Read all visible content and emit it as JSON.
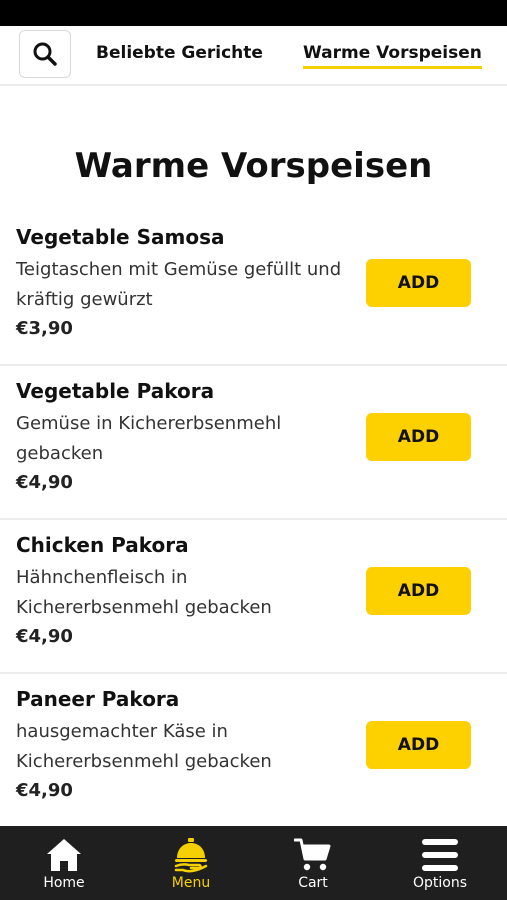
{
  "top_nav": {
    "tabs": [
      {
        "label": "Beliebte Gerichte"
      },
      {
        "label": "Warme Vorspeisen"
      }
    ]
  },
  "section": {
    "title": "Warme Vorspeisen"
  },
  "items": [
    {
      "name": "Vegetable Samosa",
      "description": "Teigtaschen mit Gemüse gefüllt und kräftig gewürzt",
      "price": "€3,90",
      "add_label": "ADD"
    },
    {
      "name": "Vegetable Pakora",
      "description": "Gemüse in Kichererbsenmehl gebacken",
      "price": "€4,90",
      "add_label": "ADD"
    },
    {
      "name": "Chicken Pakora",
      "description": "Hähnchenfleisch in Kichererbsenmehl gebacken",
      "price": "€4,90",
      "add_label": "ADD"
    },
    {
      "name": "Paneer Pakora",
      "description": "hausgemachter Käse in Kichererbsenmehl gebacken",
      "price": "€4,90",
      "add_label": "ADD"
    }
  ],
  "bottom_nav": {
    "items": [
      {
        "label": "Home",
        "icon": "home-icon"
      },
      {
        "label": "Menu",
        "icon": "cloche-icon"
      },
      {
        "label": "Cart",
        "icon": "cart-icon"
      },
      {
        "label": "Options",
        "icon": "hamburger-icon"
      }
    ],
    "active": "Menu"
  },
  "colors": {
    "accent": "#fdd000",
    "bottom_bar": "#1f1f1f",
    "status_bar": "#000000"
  }
}
